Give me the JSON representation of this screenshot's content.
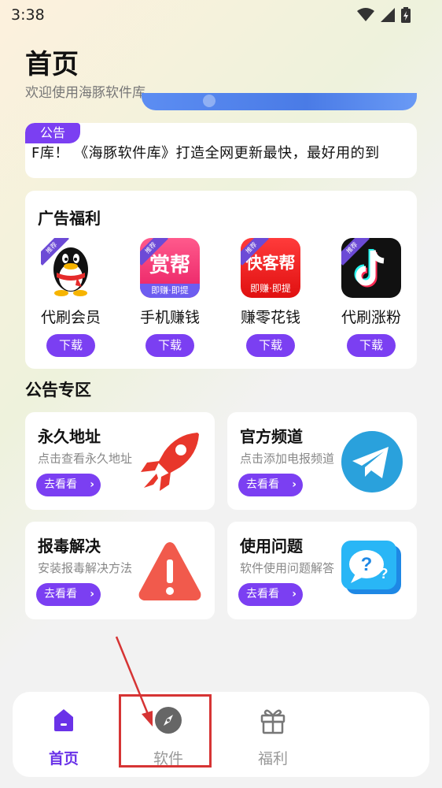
{
  "status_bar": {
    "time": "3:38"
  },
  "header": {
    "title": "首页",
    "subtitle": "欢迎使用海豚软件库"
  },
  "notice": {
    "tag": "公告",
    "text": "F库！  《海豚软件库》打造全网更新最快，最好用的到"
  },
  "ads": {
    "title": "广告福利",
    "badge": "推荐",
    "items": [
      {
        "label": "代刷会员",
        "button": "下载",
        "icon": "qq-penguin-icon",
        "art_text": ""
      },
      {
        "label": "手机赚钱",
        "button": "下载",
        "icon": "money-app-icon",
        "art_text": "赏帮",
        "art_sub": "即赚·即提"
      },
      {
        "label": "赚零花钱",
        "button": "下载",
        "icon": "kuaikebang-app-icon",
        "art_text": "快客帮",
        "art_sub": "即赚·即提"
      },
      {
        "label": "代刷涨粉",
        "button": "下载",
        "icon": "tiktok-icon",
        "art_text": ""
      }
    ]
  },
  "announcements": {
    "heading": "公告专区",
    "tiles": [
      {
        "title": "永久地址",
        "desc": "点击查看永久地址",
        "button": "去看看",
        "icon": "rocket-icon"
      },
      {
        "title": "官方频道",
        "desc": "点击添加电报频道",
        "button": "去看看",
        "icon": "telegram-icon"
      },
      {
        "title": "报毒解决",
        "desc": "安装报毒解决方法",
        "button": "去看看",
        "icon": "warning-icon"
      },
      {
        "title": "使用问题",
        "desc": "软件使用问题解答",
        "button": "去看看",
        "icon": "question-chat-icon"
      }
    ]
  },
  "bottom_nav": {
    "items": [
      {
        "label": "首页",
        "icon": "home-icon",
        "active": true
      },
      {
        "label": "软件",
        "icon": "compass-icon",
        "active": false
      },
      {
        "label": "福利",
        "icon": "gift-icon",
        "active": false
      }
    ]
  },
  "colors": {
    "accent": "#7b3ff2",
    "nav_active": "#6a32e8",
    "annotation": "#d63434"
  }
}
